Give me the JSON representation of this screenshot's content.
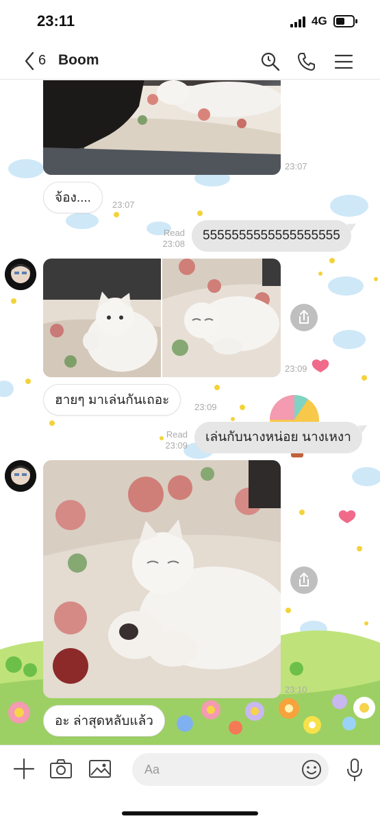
{
  "status_bar": {
    "time": "23:11",
    "network": "4G"
  },
  "header": {
    "back_count": "6",
    "chat_name": "Boom"
  },
  "messages": [
    {
      "type": "photo",
      "from": "other",
      "time": "23:07"
    },
    {
      "type": "text",
      "from": "other",
      "text": "จ้อง....",
      "time": "23:07"
    },
    {
      "type": "text",
      "from": "me",
      "text": "5555555555555555555",
      "read": "Read",
      "time": "23:08"
    },
    {
      "type": "photo_pair",
      "from": "other",
      "time": "23:09"
    },
    {
      "type": "text",
      "from": "other",
      "text": "ฮายๆ มาเล่นกันเถอะ",
      "time": "23:09"
    },
    {
      "type": "text",
      "from": "me",
      "text": "เล่นกับนางหน่อย นางเหงา",
      "read": "Read",
      "time": "23:09"
    },
    {
      "type": "photo",
      "from": "other",
      "time": "23:10"
    },
    {
      "type": "text",
      "from": "other",
      "text": "อะ ล่าสุดหลับแล้ว"
    }
  ],
  "input": {
    "placeholder": "Aa"
  },
  "icons": [
    "back-chevron-icon",
    "search-icon",
    "phone-icon",
    "menu-icon",
    "plus-icon",
    "camera-icon",
    "image-icon",
    "emoji-icon",
    "microphone-icon",
    "share-icon"
  ]
}
